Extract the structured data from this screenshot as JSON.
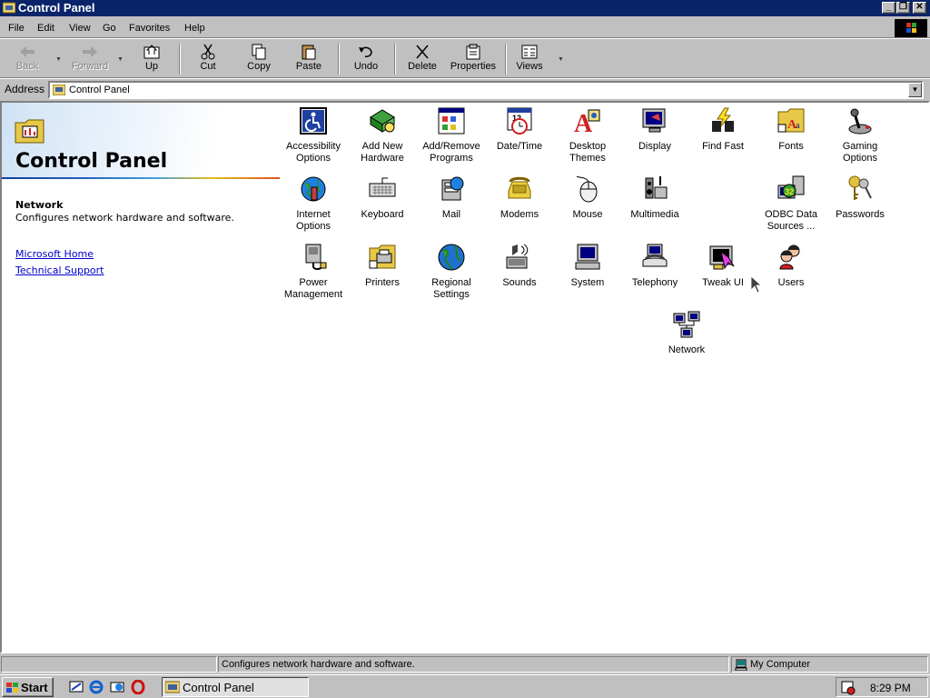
{
  "window": {
    "title": "Control Panel"
  },
  "menu": {
    "items": [
      {
        "label": "File"
      },
      {
        "label": "Edit"
      },
      {
        "label": "View"
      },
      {
        "label": "Go"
      },
      {
        "label": "Favorites"
      },
      {
        "label": "Help"
      }
    ]
  },
  "toolbar": {
    "back": "Back",
    "forward": "Forward",
    "up": "Up",
    "cut": "Cut",
    "copy": "Copy",
    "paste": "Paste",
    "undo": "Undo",
    "delete": "Delete",
    "properties": "Properties",
    "views": "Views"
  },
  "address": {
    "label": "Address",
    "value": "Control Panel"
  },
  "left_pane": {
    "title": "Control Panel",
    "selected_name": "Network",
    "selected_description": "Configures network hardware and software.",
    "links": [
      "Microsoft Home",
      "Technical Support"
    ]
  },
  "icons": [
    {
      "label": "Accessibility Options",
      "icon": "accessibility-icon"
    },
    {
      "label": "Add New Hardware",
      "icon": "add-hardware-icon"
    },
    {
      "label": "Add/Remove Programs",
      "icon": "add-remove-programs-icon"
    },
    {
      "label": "Date/Time",
      "icon": "calendar-clock-icon"
    },
    {
      "label": "Desktop Themes",
      "icon": "desktop-themes-icon"
    },
    {
      "label": "Display",
      "icon": "monitor-icon"
    },
    {
      "label": "Find Fast",
      "icon": "binoculars-icon"
    },
    {
      "label": "Fonts",
      "icon": "fonts-folder-icon"
    },
    {
      "label": "Gaming Options",
      "icon": "joystick-icon"
    },
    {
      "label": "Internet Options",
      "icon": "internet-globe-icon"
    },
    {
      "label": "Keyboard",
      "icon": "keyboard-icon"
    },
    {
      "label": "Mail",
      "icon": "mail-icon"
    },
    {
      "label": "Modems",
      "icon": "modem-phone-icon"
    },
    {
      "label": "Mouse",
      "icon": "mouse-icon"
    },
    {
      "label": "Multimedia",
      "icon": "multimedia-icon"
    },
    {
      "label": "ODBC Data Sources ...",
      "icon": "odbc-database-icon"
    },
    {
      "label": "Passwords",
      "icon": "keys-icon"
    },
    {
      "label": "Power Management",
      "icon": "power-plug-icon"
    },
    {
      "label": "Printers",
      "icon": "printers-folder-icon"
    },
    {
      "label": "Regional Settings",
      "icon": "globe-icon"
    },
    {
      "label": "Sounds",
      "icon": "speaker-icon"
    },
    {
      "label": "System",
      "icon": "computer-icon"
    },
    {
      "label": "Telephony",
      "icon": "telephone-icon"
    },
    {
      "label": "Tweak UI",
      "icon": "tweak-ui-icon"
    },
    {
      "label": "Users",
      "icon": "users-icon"
    },
    {
      "label": "Network",
      "icon": "network-icon"
    }
  ],
  "status": {
    "message": "Configures network hardware and software.",
    "zone": "My Computer"
  },
  "taskbar": {
    "start": "Start",
    "task": "Control Panel",
    "clock": "8:29 PM"
  },
  "colors": {
    "title_bar": "#0a246a",
    "desktop_gray": "#c0c0c0",
    "link": "#0000cc"
  }
}
